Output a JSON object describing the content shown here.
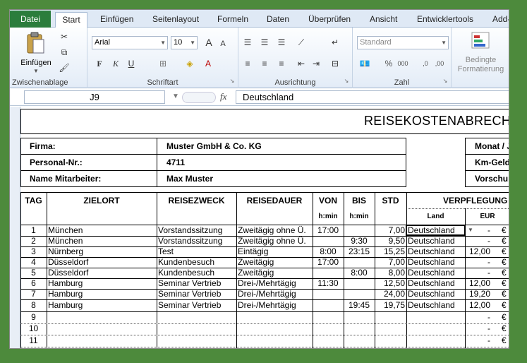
{
  "tabs": [
    "Datei",
    "Start",
    "Einfügen",
    "Seitenlayout",
    "Formeln",
    "Daten",
    "Überprüfen",
    "Ansicht",
    "Entwicklertools",
    "Add-"
  ],
  "ribbon": {
    "clipboard": {
      "paste_label": "Einfügen",
      "group_label": "Zwischenablage"
    },
    "font": {
      "name": "Arial",
      "size": "10",
      "group_label": "Schriftart",
      "bold": "F",
      "italic": "K",
      "underline": "U"
    },
    "alignment": {
      "group_label": "Ausrichtung"
    },
    "number": {
      "format": "Standard",
      "group_label": "Zahl",
      "percent": "%",
      "thousands": "000"
    },
    "styles": {
      "cond_format_line1": "Bedingte",
      "cond_format_line2": "Formatierung"
    }
  },
  "formula_bar": {
    "name_box": "J9",
    "fx": "fx",
    "value": "Deutschland"
  },
  "sheet": {
    "title": "REISEKOSTENABRECH",
    "info": {
      "firma_label": "Firma:",
      "firma_value": "Muster GmbH & Co. KG",
      "personal_label": "Personal-Nr.:",
      "personal_value": "4711",
      "name_label": "Name Mitarbeiter:",
      "name_value": "Max Muster",
      "monat_label": "Monat / J",
      "kmgeld_label": "Km-Geld j",
      "vorschuss_label": "Vorschuß"
    },
    "headers": {
      "tag": "TAG",
      "zielort": "ZIELORT",
      "reisezweck": "REISEZWECK",
      "reisedauer": "REISEDAUER",
      "von": "VON",
      "bis": "BIS",
      "std": "STD",
      "verpflegung": "VERPFLEGUNG",
      "hmin1": "h:min",
      "hmin2": "h:min",
      "land": "Land",
      "eur": "EUR"
    },
    "rows": [
      {
        "tag": "1",
        "ort": "München",
        "zweck": "Vorstandssitzung",
        "dauer": "Zweitägig ohne Ü.",
        "von": "17:00",
        "bis": "",
        "std": "7,00",
        "land": "Deutschland",
        "eur": "-"
      },
      {
        "tag": "2",
        "ort": "München",
        "zweck": "Vorstandssitzung",
        "dauer": "Zweitägig ohne Ü.",
        "von": "",
        "bis": "9:30",
        "std": "9,50",
        "land": "Deutschland",
        "eur": "-"
      },
      {
        "tag": "3",
        "ort": "Nürnberg",
        "zweck": "Test",
        "dauer": "Eintägig",
        "von": "8:00",
        "bis": "23:15",
        "std": "15,25",
        "land": "Deutschland",
        "eur": "12,00"
      },
      {
        "tag": "4",
        "ort": "Düsseldorf",
        "zweck": "Kundenbesuch",
        "dauer": "Zweitägig",
        "von": "17:00",
        "bis": "",
        "std": "7,00",
        "land": "Deutschland",
        "eur": "-"
      },
      {
        "tag": "5",
        "ort": "Düsseldorf",
        "zweck": "Kundenbesuch",
        "dauer": "Zweitägig",
        "von": "",
        "bis": "8:00",
        "std": "8,00",
        "land": "Deutschland",
        "eur": "-"
      },
      {
        "tag": "6",
        "ort": "Hamburg",
        "zweck": "Seminar Vertrieb",
        "dauer": "Drei-/Mehrtägig",
        "von": "11:30",
        "bis": "",
        "std": "12,50",
        "land": "Deutschland",
        "eur": "12,00"
      },
      {
        "tag": "7",
        "ort": "Hamburg",
        "zweck": "Seminar Vertrieb",
        "dauer": "Drei-/Mehrtägig",
        "von": "",
        "bis": "",
        "std": "24,00",
        "land": "Deutschland",
        "eur": "19,20"
      },
      {
        "tag": "8",
        "ort": "Hamburg",
        "zweck": "Seminar Vertrieb",
        "dauer": "Drei-/Mehrtägig",
        "von": "",
        "bis": "19:45",
        "std": "19,75",
        "land": "Deutschland",
        "eur": "12,00"
      },
      {
        "tag": "9",
        "ort": "",
        "zweck": "",
        "dauer": "",
        "von": "",
        "bis": "",
        "std": "",
        "land": "",
        "eur": "-"
      },
      {
        "tag": "10",
        "ort": "",
        "zweck": "",
        "dauer": "",
        "von": "",
        "bis": "",
        "std": "",
        "land": "",
        "eur": "-"
      },
      {
        "tag": "11",
        "ort": "",
        "zweck": "",
        "dauer": "",
        "von": "",
        "bis": "",
        "std": "",
        "land": "",
        "eur": "-"
      }
    ],
    "currency": "€"
  }
}
